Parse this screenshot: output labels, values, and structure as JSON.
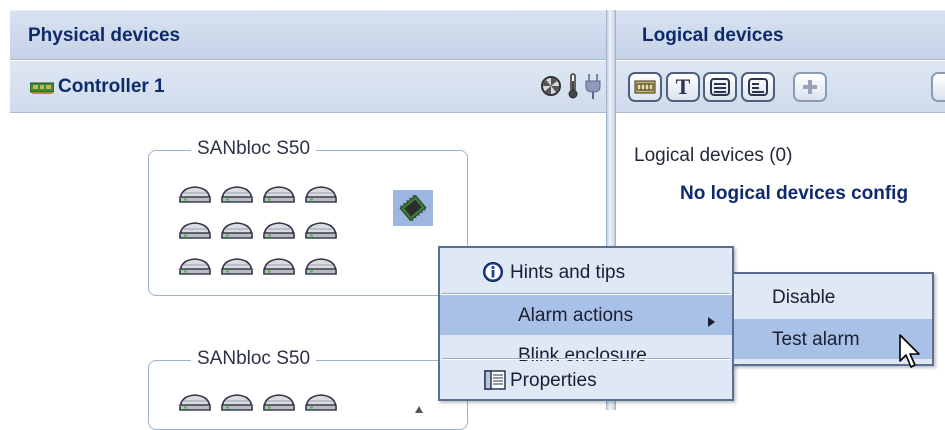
{
  "panels": {
    "physical_title": "Physical devices",
    "logical_title": "Logical devices"
  },
  "controller": {
    "label": "Controller 1"
  },
  "enclosures": [
    {
      "label": "SANbloc S50"
    },
    {
      "label": "SANbloc S50"
    }
  ],
  "logical": {
    "count_label": "Logical devices (0)",
    "empty_message": "No logical devices config"
  },
  "context_menu": {
    "items": [
      {
        "label": "Hints and tips",
        "icon": "info-icon"
      },
      {
        "label": "Alarm actions",
        "icon": "submenu-arrow-icon"
      },
      {
        "label": "Blink enclosure"
      },
      {
        "label": "Properties",
        "icon": "properties-icon"
      }
    ]
  },
  "submenu": {
    "items": [
      {
        "label": "Disable"
      },
      {
        "label": "Test alarm"
      }
    ]
  },
  "colors": {
    "header_text": "#0d2a6b",
    "highlight": "#a9c1e6",
    "menu_bg": "#dfe8f5"
  }
}
